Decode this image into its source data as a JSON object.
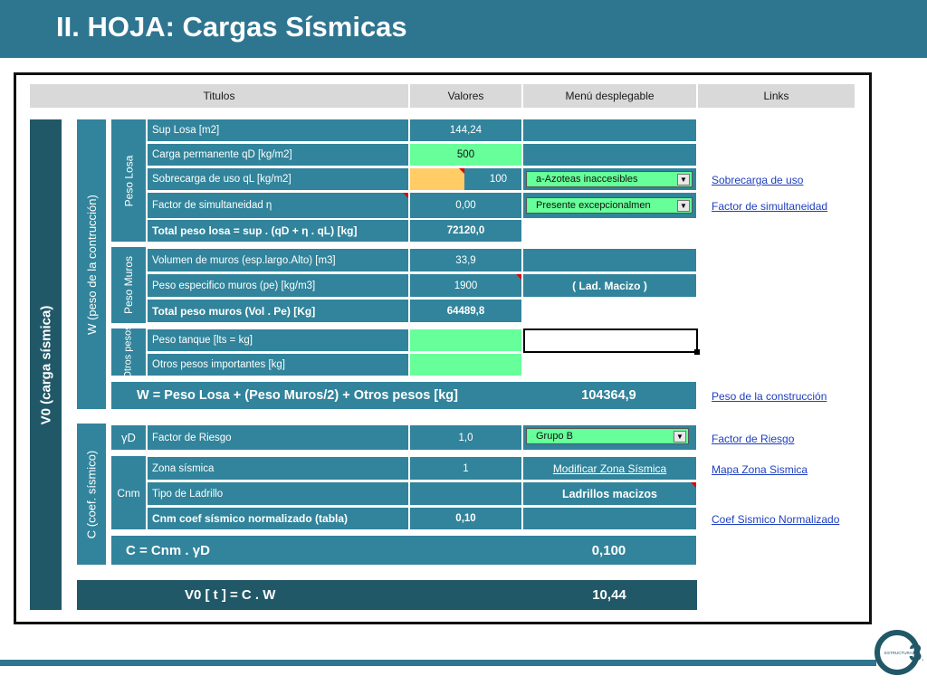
{
  "slide": {
    "title": "II. HOJA: Cargas Sísmicas"
  },
  "headers": {
    "titulos": "Titulos",
    "valores": "Valores",
    "menu": "Menú desplegable",
    "links": "Links"
  },
  "side_labels": {
    "v0": "V0 (carga sísmica)",
    "w": "W (peso de la contrucción)",
    "c": "C (coef. sísmico)",
    "peso_losa": "Peso Losa",
    "peso_muros": "Peso Muros",
    "otros_pesos": "Otros pesos",
    "gamma_d": "γD",
    "cnm": "Cnm"
  },
  "rows": {
    "sup_losa": {
      "label": "Sup Losa [m2]",
      "value": "144,24"
    },
    "carga_permanente": {
      "label": "Carga permanente qD [kg/m2]",
      "value": "500"
    },
    "sobrecarga": {
      "label": "Sobrecarga de uso qL [kg/m2]",
      "value": "100",
      "select": "a-Azoteas inaccesibles",
      "link": "Sobrecarga  de  uso"
    },
    "factor_simultaneidad": {
      "label": "Factor de simultaneidad η",
      "value": "0,00",
      "select": "Presente excepcionalmen",
      "link": "Factor  de  simultaneidad"
    },
    "total_losa": {
      "label": "Total peso losa = sup . (qD + η  . qL) [kg]",
      "value": "72120,0"
    },
    "volumen_muros": {
      "label": "Volumen de muros (esp.largo.Alto) [m3]",
      "value": "33,9"
    },
    "peso_especifico": {
      "label": "Peso especifico muros (pe) [kg/m3]",
      "value": "1900",
      "menu": "( Lad. Macizo )"
    },
    "total_muros": {
      "label": "Total peso muros (Vol . Pe) [Kg]",
      "value": "64489,8"
    },
    "peso_tanque": {
      "label": "Peso tanque [lts = kg]",
      "value": ""
    },
    "otros_importantes": {
      "label": "Otros pesos importantes [kg]",
      "value": ""
    },
    "w_total": {
      "label": "W = Peso Losa + (Peso Muros/2) + Otros pesos [kg]",
      "value": "104364,9",
      "link": "Peso de la construcción"
    },
    "factor_riesgo": {
      "label": "Factor de Riesgo",
      "value": "1,0",
      "select": "Grupo B",
      "link": "Factor de Riesgo"
    },
    "zona_sismica": {
      "label": "Zona sísmica",
      "value": "1",
      "menu": "Modificar Zona Sísmica",
      "link": "Mapa  Zona  Sismica"
    },
    "tipo_ladrillo": {
      "label": "Tipo de Ladrillo",
      "menu": "Ladrillos macizos"
    },
    "cnm_coef": {
      "label": "Cnm coef sísmico normalizado (tabla)",
      "value": "0,10",
      "link": "Coef  Sismico  Normalizado"
    },
    "c_total": {
      "label": "C = Cnm . γD",
      "value": "0,100"
    },
    "v0_total": {
      "label": "V0 [ t ] = C . W",
      "value": "10,44"
    }
  },
  "colors": {
    "header": "#2e7590",
    "dark_teal": "#215868",
    "teal": "#31849b",
    "input_green": "#66ff99",
    "input_orange": "#ffcc66"
  },
  "logo": {
    "text": "ESTRUCTURAS",
    "mark": "3A"
  }
}
